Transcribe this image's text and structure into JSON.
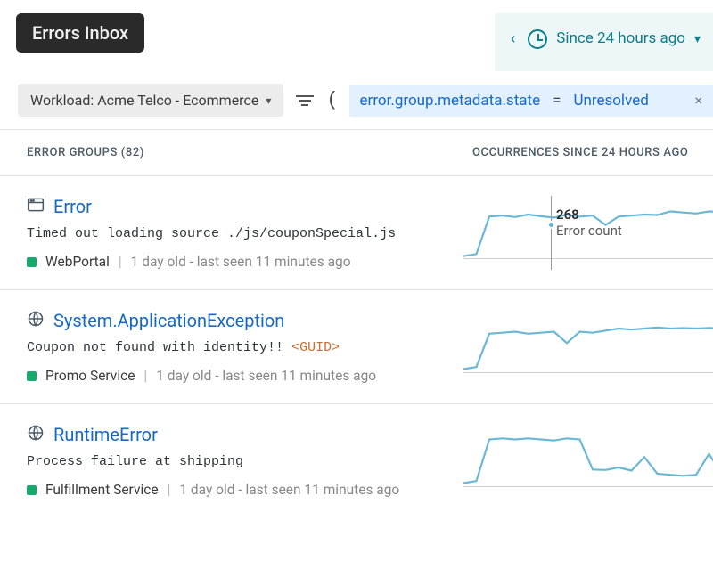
{
  "header": {
    "title": "Errors Inbox",
    "time_range": "Since 24 hours ago"
  },
  "filters": {
    "workload_label": "Workload: Acme Telco - Ecommerce",
    "chip": {
      "key": "error.group.metadata.state",
      "op": "=",
      "value": "Unresolved"
    }
  },
  "columns": {
    "groups": "ERROR GROUPS (82)",
    "occurrences": "OCCURRENCES SINCE 24 HOURS AGO"
  },
  "rows": [
    {
      "icon": "browser",
      "name": "Error",
      "message": "Timed out loading source ./js/couponSpecial.js",
      "guid": "",
      "service": "WebPortal",
      "age": "1 day old - last seen 11 minutes ago",
      "tooltip_value": "268",
      "tooltip_label": "Error count"
    },
    {
      "icon": "globe",
      "name": "System.ApplicationException",
      "message": "Coupon not found with identity!! ",
      "guid": "<GUID>",
      "service": "Promo Service",
      "age": "1 day old - last seen 11 minutes ago"
    },
    {
      "icon": "globe",
      "name": "RuntimeError",
      "message": "Process failure at shipping",
      "guid": "",
      "service": "Fulfillment Service",
      "age": "1 day old - last seen 11 minutes ago"
    }
  ],
  "chart_data": [
    {
      "type": "line",
      "title": "Error occurrences",
      "ylim": [
        0,
        300
      ],
      "values": [
        10,
        20,
        200,
        205,
        198,
        210,
        202,
        195,
        210,
        200,
        205,
        160,
        200,
        205,
        210,
        208,
        225,
        220,
        215,
        225,
        222
      ],
      "highlight": {
        "index": 10,
        "value": 268,
        "label": "Error count"
      }
    },
    {
      "type": "line",
      "title": "System.ApplicationException occurrences",
      "ylim": [
        0,
        300
      ],
      "values": [
        15,
        25,
        185,
        190,
        195,
        185,
        190,
        195,
        140,
        195,
        190,
        200,
        210,
        205,
        210,
        215,
        210,
        212,
        210,
        213,
        210
      ]
    },
    {
      "type": "line",
      "title": "RuntimeError occurrences",
      "ylim": [
        0,
        300
      ],
      "values": [
        15,
        25,
        225,
        230,
        225,
        230,
        225,
        220,
        230,
        225,
        80,
        78,
        90,
        75,
        140,
        60,
        55,
        50,
        55,
        155,
        58
      ]
    }
  ]
}
